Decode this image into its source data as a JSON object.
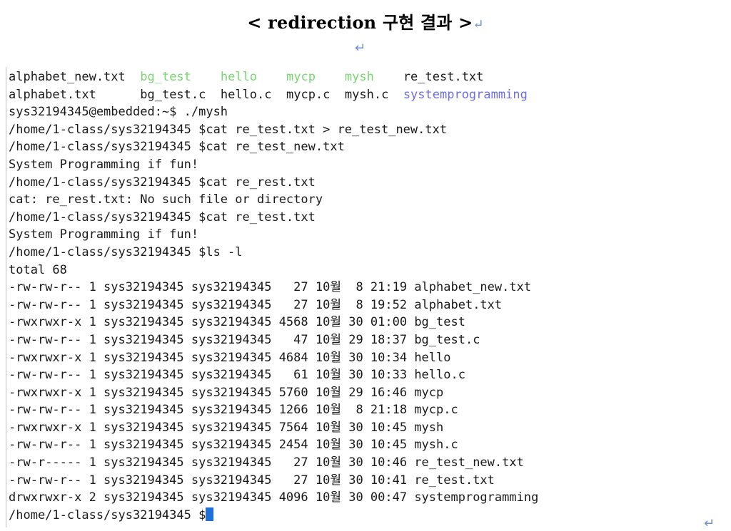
{
  "title": {
    "text": "< redirection 구현 결과 >",
    "return_mark": "↵"
  },
  "para_marks": [
    "↵",
    "↵"
  ],
  "terminal": {
    "ls_row1": [
      {
        "text": "alphabet_new.txt",
        "color": "default"
      },
      {
        "text": "bg_test",
        "color": "green"
      },
      {
        "text": "hello",
        "color": "green"
      },
      {
        "text": "mycp",
        "color": "green"
      },
      {
        "text": "mysh",
        "color": "green"
      },
      {
        "text": "re_test.txt",
        "color": "default"
      }
    ],
    "ls_row2": [
      {
        "text": "alphabet.txt",
        "color": "default"
      },
      {
        "text": "bg_test.c",
        "color": "default"
      },
      {
        "text": "hello.c",
        "color": "default"
      },
      {
        "text": "mycp.c",
        "color": "default"
      },
      {
        "text": "mysh.c",
        "color": "default"
      },
      {
        "text": "systemprogramming",
        "color": "blue"
      }
    ],
    "lines": [
      "sys32194345@embedded:~$ ./mysh",
      "/home/1-class/sys32194345 $cat re_test.txt > re_test_new.txt",
      "/home/1-class/sys32194345 $cat re_test_new.txt",
      "System Programming if fun!",
      "/home/1-class/sys32194345 $cat re_rest.txt",
      "cat: re_rest.txt: No such file or directory",
      "/home/1-class/sys32194345 $cat re_test.txt",
      "System Programming if fun!",
      "/home/1-class/sys32194345 $ls -l",
      "total 68",
      "-rw-rw-r-- 1 sys32194345 sys32194345   27 10월  8 21:19 alphabet_new.txt",
      "-rw-rw-r-- 1 sys32194345 sys32194345   27 10월  8 19:52 alphabet.txt",
      "-rwxrwxr-x 1 sys32194345 sys32194345 4568 10월 30 01:00 bg_test",
      "-rw-rw-r-- 1 sys32194345 sys32194345   47 10월 29 18:37 bg_test.c",
      "-rwxrwxr-x 1 sys32194345 sys32194345 4684 10월 30 10:34 hello",
      "-rw-rw-r-- 1 sys32194345 sys32194345   61 10월 30 10:33 hello.c",
      "-rwxrwxr-x 1 sys32194345 sys32194345 5760 10월 29 16:46 mycp",
      "-rw-rw-r-- 1 sys32194345 sys32194345 1266 10월  8 21:18 mycp.c",
      "-rwxrwxr-x 1 sys32194345 sys32194345 7564 10월 30 10:45 mysh",
      "-rw-rw-r-- 1 sys32194345 sys32194345 2454 10월 30 10:45 mysh.c",
      "-rw-r----- 1 sys32194345 sys32194345   27 10월 30 10:46 re_test_new.txt",
      "-rw-rw-r-- 1 sys32194345 sys32194345   27 10월 30 10:41 re_test.txt",
      "drwxrwxr-x 2 sys32194345 sys32194345 4096 10월 30 00:47 systemprogramming"
    ],
    "prompt": "/home/1-class/sys32194345 $",
    "colors": {
      "green": "#76d86e",
      "blue": "#6f6fe0",
      "cursor": "#1f6fd6"
    }
  }
}
